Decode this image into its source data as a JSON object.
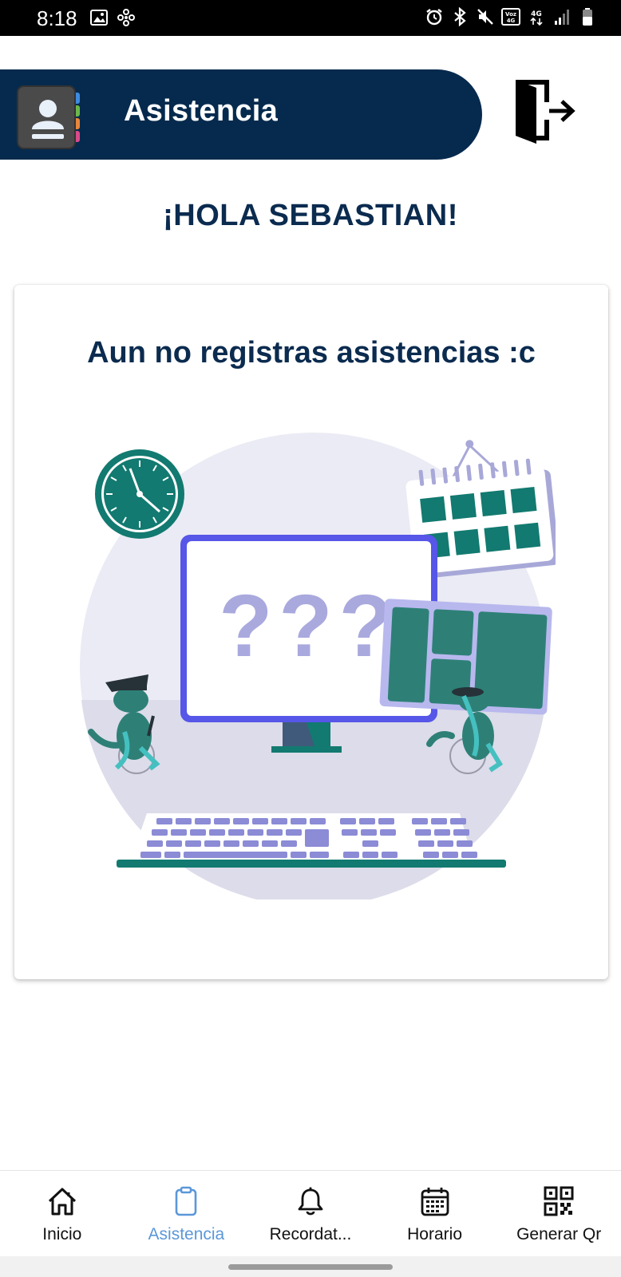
{
  "status_bar": {
    "time": "8:18",
    "left_icons": [
      "gallery-icon",
      "pinwheel-icon"
    ],
    "right_icons": [
      "alarm-icon",
      "bluetooth-icon",
      "mute-icon",
      "volte-icon",
      "network-4g-icon",
      "signal-icon",
      "battery-icon"
    ],
    "volte_label": "Voz 4G",
    "network_label": "4G"
  },
  "header": {
    "title": "Asistencia",
    "logo_icon": "contacts-book-icon",
    "logout_icon": "logout-door-icon",
    "color": "#062A4D"
  },
  "greeting": "¡HOLA SEBASTIAN!",
  "card": {
    "title": "Aun no registras asistencias :c",
    "illustration": {
      "question_marks": "???",
      "description_icon": "empty-attendance-illustration"
    }
  },
  "bottom_nav": {
    "items": [
      {
        "label": "Inicio",
        "icon": "home-icon",
        "active": false
      },
      {
        "label": "Asistencia",
        "icon": "clipboard-icon",
        "active": true
      },
      {
        "label": "Recordat...",
        "icon": "bell-icon",
        "active": false
      },
      {
        "label": "Horario",
        "icon": "calendar-icon",
        "active": false
      },
      {
        "label": "Generar Qr",
        "icon": "qr-code-icon",
        "active": false
      }
    ],
    "active_color": "#5B97D9"
  }
}
